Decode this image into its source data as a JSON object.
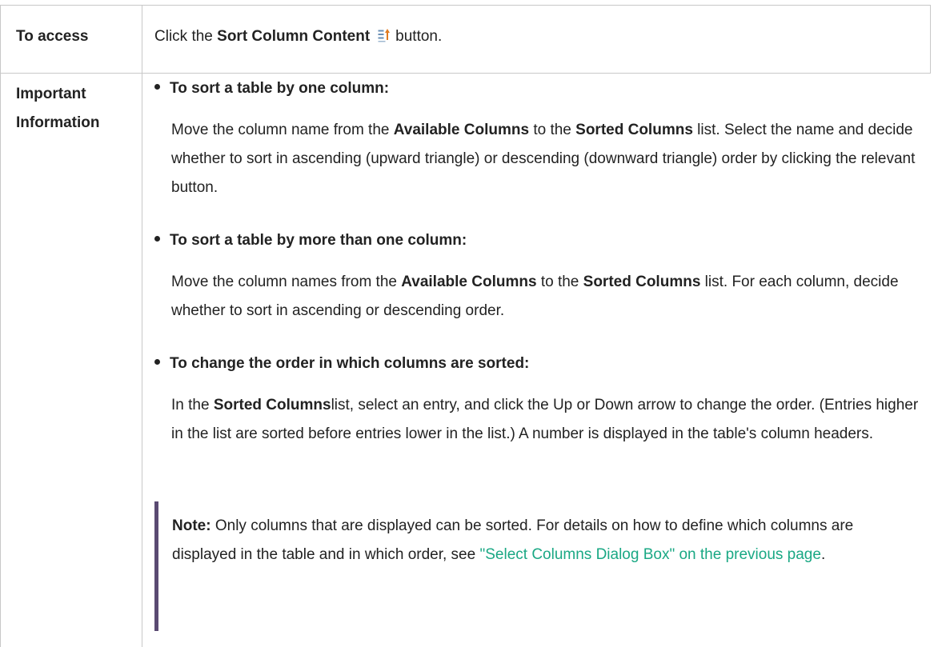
{
  "rows": [
    {
      "header": "To access",
      "content": {
        "prefix": "Click the",
        "button_name": "Sort Column Content",
        "suffix": "button.",
        "icon": "sort-column-content-icon"
      }
    },
    {
      "header": "Important Information",
      "bullets": [
        {
          "title": "To sort a table by one column:",
          "text_1": "Move the column name from the",
          "bold_1": "Available Columns",
          "text_2": "to the",
          "bold_2": "Sorted Columns",
          "text_3": "list. Select the name and decide whether to sort in ascending (upward triangle) or descending (downward triangle) order by clicking the relevant button."
        },
        {
          "title": "To sort a table by more than one column:",
          "text_1": "Move the column names from the",
          "bold_1": "Available Columns",
          "text_2": "to the",
          "bold_2": "Sorted Columns",
          "text_3": "list. For each column, decide whether to sort in ascending or descending order."
        },
        {
          "title": "To change the order in which columns are sorted:",
          "text_1": "In the",
          "bold_1": "Sorted Columns",
          "text_2": "list, select an entry, and click the Up or Down arrow to change the order. (Entries higher in the list are sorted before entries lower in the list.) A number is displayed in the table's column headers."
        }
      ],
      "note": {
        "label": "Note:",
        "text": "Only columns that are displayed can be sorted. For details on how to define which columns are displayed in the table and in which order, see",
        "link": "\"Select Columns Dialog Box\" on the previous page",
        "end": "."
      }
    }
  ],
  "colors": {
    "link": "#1aa884",
    "note_bar": "#5a4a72",
    "border": "#c8c8c8"
  }
}
